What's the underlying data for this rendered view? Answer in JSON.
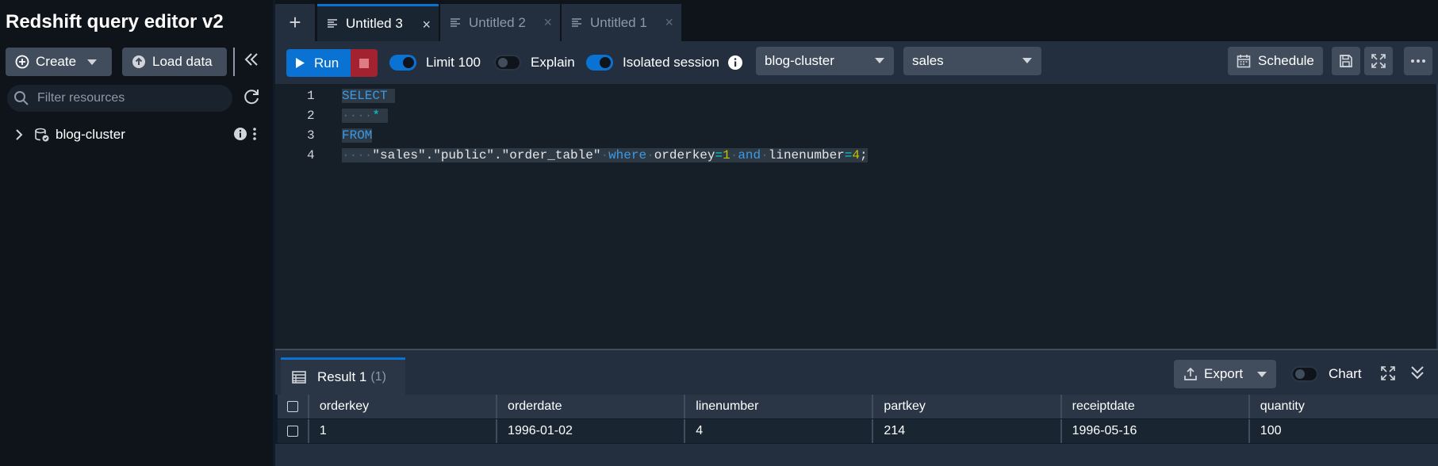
{
  "sidebar": {
    "title": "Redshift query editor v2",
    "create_label": "Create",
    "load_label": "Load data",
    "filter_placeholder": "Filter resources",
    "tree": [
      {
        "label": "blog-cluster"
      }
    ]
  },
  "tabs": [
    {
      "label": "Untitled 3",
      "active": true
    },
    {
      "label": "Untitled 2",
      "active": false
    },
    {
      "label": "Untitled 1",
      "active": false
    }
  ],
  "toolbar": {
    "run_label": "Run",
    "limit_label": "Limit 100",
    "limit_on": true,
    "explain_label": "Explain",
    "explain_on": false,
    "isolated_label": "Isolated session",
    "isolated_on": true,
    "cluster": "blog-cluster",
    "database": "sales",
    "schedule_label": "Schedule"
  },
  "editor": {
    "line_numbers": [
      "1",
      "2",
      "3",
      "4"
    ],
    "line1": "SELECT",
    "line2_star": "*",
    "line3": "FROM",
    "line4": {
      "table": "\"sales\".\"public\".\"order_table\"",
      "where": "where",
      "col1": "orderkey",
      "eq": "=",
      "val1": "1",
      "and": "and",
      "col2": "linenumber",
      "val2": "4",
      "semi": ";"
    }
  },
  "results": {
    "tab_label": "Result 1",
    "count": "(1)",
    "export_label": "Export",
    "chart_label": "Chart",
    "chart_on": false,
    "columns": [
      "orderkey",
      "orderdate",
      "linenumber",
      "partkey",
      "receiptdate",
      "quantity"
    ],
    "rows": [
      [
        "1",
        "1996-01-02",
        "4",
        "214",
        "1996-05-16",
        "100"
      ]
    ]
  },
  "colors": {
    "accent": "#0972d3",
    "stop": "#a32230",
    "background": "#0f141a"
  }
}
